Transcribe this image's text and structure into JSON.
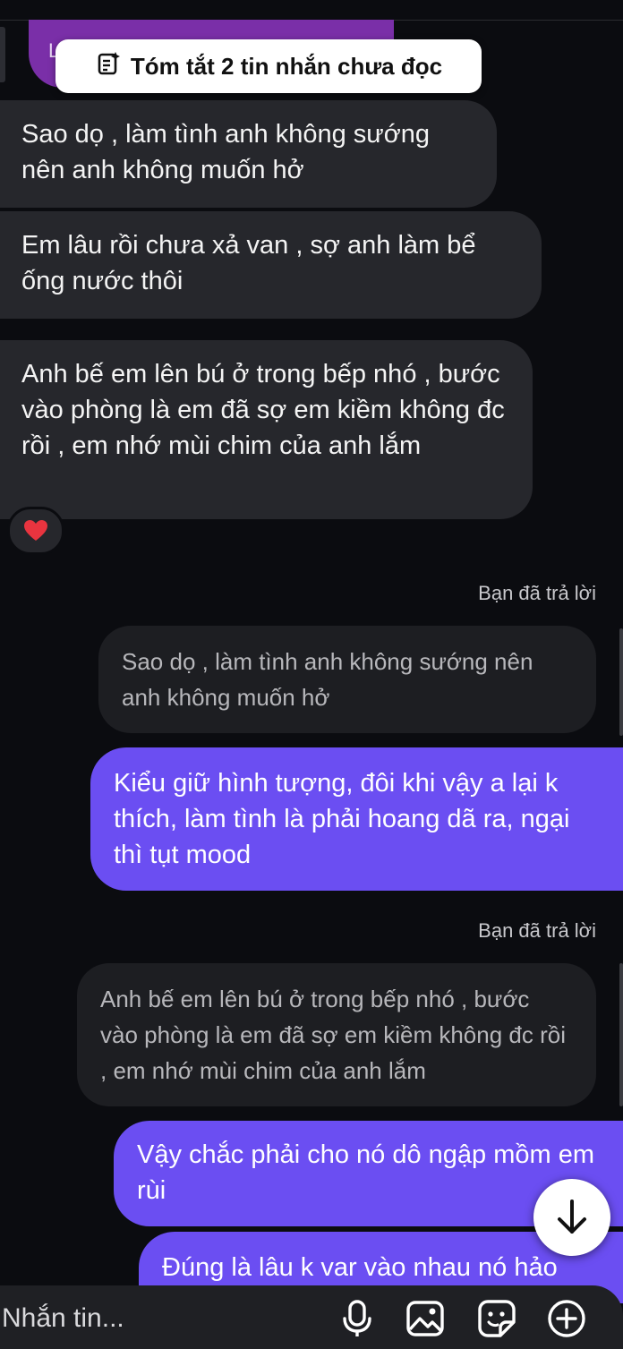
{
  "summary": {
    "label": "Tóm tắt 2 tin nhắn chưa đọc",
    "icon": "summary-note-icon"
  },
  "top_peek": {
    "partial_text": "L"
  },
  "messages_in": [
    {
      "text": "Sao dọ , làm tình anh không sướng nên anh không muốn hở"
    },
    {
      "text": "Em lâu rồi chưa xả van , sợ anh làm bể ống nước thôi"
    },
    {
      "text": "Anh bế em lên bú ở trong bếp nhó , bước vào phòng là em đã sợ em kiềm không đc rồi , em nhớ mùi chim của anh lắm",
      "reaction": "heart"
    }
  ],
  "replies": [
    {
      "label": "Bạn đã trả lời",
      "quoted": "Sao dọ , làm tình anh không sướng nên anh không muốn hở",
      "text": "Kiểu giữ hình tượng, đôi khi vậy a lại k thích, làm tình là phải hoang dã ra, ngại thì tụt mood"
    },
    {
      "label": "Bạn đã trả lời",
      "quoted": "Anh bế em lên bú ở trong bếp nhó , bước vào phòng là em đã sợ em kiềm không đc rồi , em nhớ mùi chim của anh lắm",
      "text": "Vậy chắc phải cho nó dô ngập mồm em rùi"
    }
  ],
  "last_out": {
    "text": "Đúng là lâu k var vào nhau nó hảo"
  },
  "composer": {
    "placeholder": "Nhắn tin..."
  },
  "colors": {
    "outgoing": "#6b4ef2",
    "incoming": "#26272c",
    "quoted": "#1d1e22",
    "background": "#0b0c10"
  }
}
